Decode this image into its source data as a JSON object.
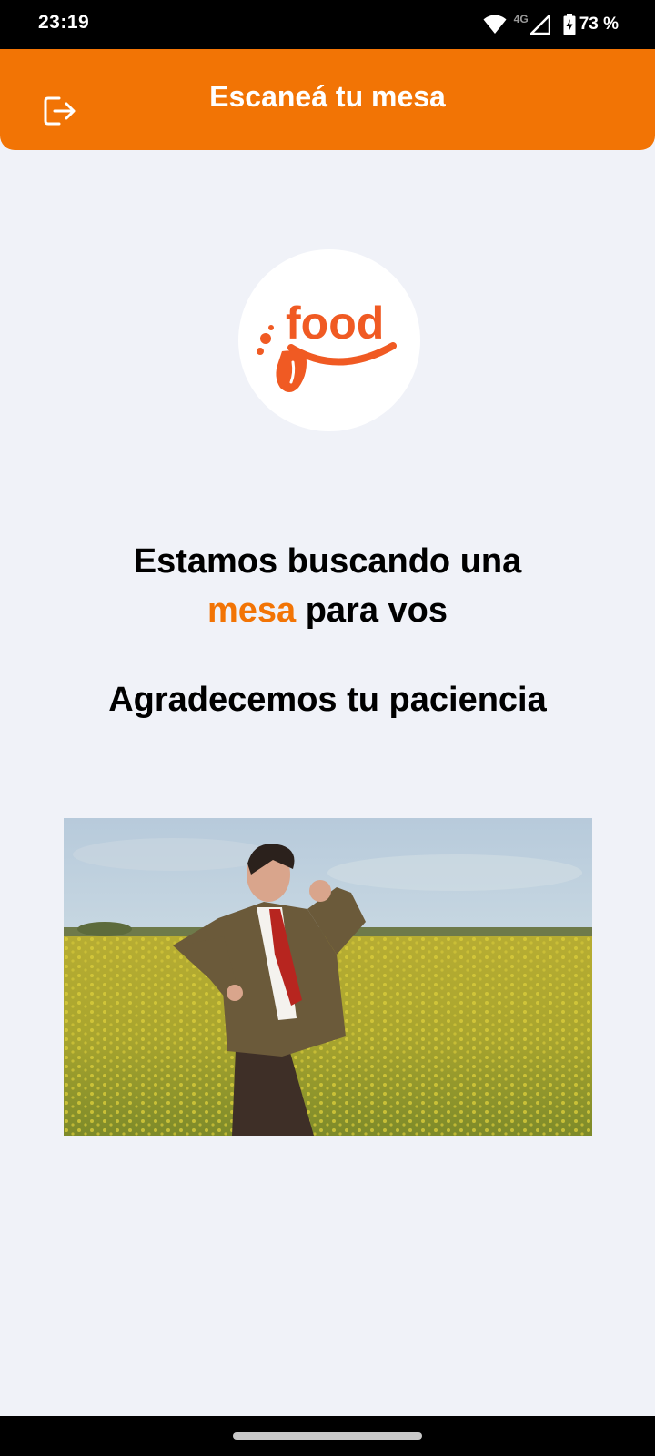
{
  "status_bar": {
    "time": "23:19",
    "network": "4G",
    "battery": "73 %",
    "icons": [
      "wifi-icon",
      "signal-icon",
      "battery-charging-icon"
    ]
  },
  "header": {
    "title": "Escaneá tu mesa",
    "logout_icon": "logout-icon",
    "background_color": "#f27405"
  },
  "logo": {
    "text": "food",
    "color": "#f05a23"
  },
  "message": {
    "line1": "Estamos buscando una",
    "highlight": "mesa",
    "line2_rest": " para vos",
    "thanks": "Agradecemos tu paciencia",
    "accent_color": "#f27405"
  },
  "waiting_image": {
    "description_icon": "waiting-animation-image"
  },
  "nav": {
    "home_indicator": "home-indicator"
  }
}
